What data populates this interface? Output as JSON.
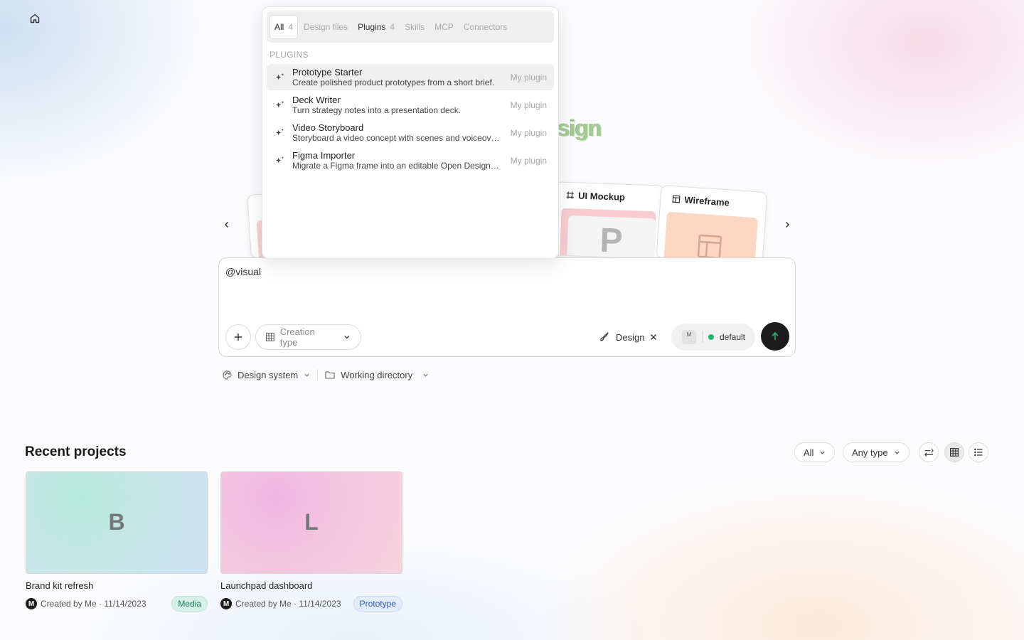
{
  "nav": {
    "home_icon": "home-icon"
  },
  "hero": {
    "fragment": "sign"
  },
  "carousel": {
    "cards": [
      {
        "title": "UI Mockup",
        "icon": "frame-icon",
        "thumb_letter": "P"
      },
      {
        "title": "Wireframe",
        "icon": "layout-icon"
      }
    ]
  },
  "dropdown": {
    "tabs": [
      {
        "label": "All",
        "count": "4",
        "active": true
      },
      {
        "label": "Design files",
        "count": ""
      },
      {
        "label": "Plugins",
        "count": "4"
      },
      {
        "label": "Skills",
        "count": ""
      },
      {
        "label": "MCP",
        "count": ""
      },
      {
        "label": "Connectors",
        "count": ""
      }
    ],
    "section_label": "PLUGINS",
    "plugins": [
      {
        "name": "Prototype Starter",
        "desc": "Create polished product prototypes from a short brief.",
        "tag": "My plugin"
      },
      {
        "name": "Deck Writer",
        "desc": "Turn strategy notes into a presentation deck.",
        "tag": "My plugin"
      },
      {
        "name": "Video Storyboard",
        "desc": "Storyboard a video concept with scenes and voiceover.",
        "tag": "My plugin"
      },
      {
        "name": "Figma Importer",
        "desc": "Migrate a Figma frame into an editable Open Design file.",
        "tag": "My plugin"
      }
    ]
  },
  "prompt": {
    "text": "@visual",
    "creation_type_placeholder": "Creation type",
    "design_chip": "Design",
    "model_badge": "M",
    "model_label": "default"
  },
  "below_prompt": {
    "design_system": "Design system",
    "working_directory": "Working directory"
  },
  "recent": {
    "title": "Recent projects",
    "filter_all": "All",
    "filter_type": "Any type",
    "projects": [
      {
        "letter": "B",
        "name": "Brand kit refresh",
        "meta": "Created by Me · 11/14/2023",
        "avatar": "M",
        "type": "Media"
      },
      {
        "letter": "L",
        "name": "Launchpad dashboard",
        "meta": "Created by Me · 11/14/2023",
        "avatar": "M",
        "type": "Prototype"
      }
    ]
  },
  "colors": {
    "accent_green": "#22b573",
    "send_button": "#1c1c1c",
    "media_badge": "#d6f1e8",
    "prototype_badge": "#e3ecfb"
  }
}
